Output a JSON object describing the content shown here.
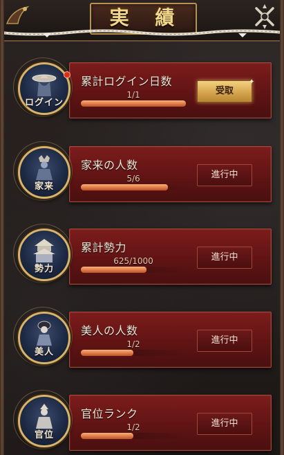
{
  "header": {
    "title": "実 績"
  },
  "achievements": [
    {
      "name": "累計ログイン日数",
      "progress_text": "1/1",
      "progress_ratio": 1.0,
      "badge_label": "ログイン",
      "button_label": "受取",
      "button_state": "claimable",
      "has_notification": true
    },
    {
      "name": "家来の人数",
      "progress_text": "5/6",
      "progress_ratio": 0.83,
      "badge_label": "家来",
      "button_label": "進行中",
      "button_state": "in-progress",
      "has_notification": false
    },
    {
      "name": "累計勢力",
      "progress_text": "625/1000",
      "progress_ratio": 0.625,
      "badge_label": "勢力",
      "button_label": "進行中",
      "button_state": "in-progress",
      "has_notification": false
    },
    {
      "name": "美人の人数",
      "progress_text": "1/2",
      "progress_ratio": 0.5,
      "badge_label": "美人",
      "button_label": "進行中",
      "button_state": "in-progress",
      "has_notification": false
    },
    {
      "name": "官位ランク",
      "progress_text": "1/2",
      "progress_ratio": 0.5,
      "badge_label": "官位",
      "button_label": "進行中",
      "button_state": "in-progress",
      "has_notification": false
    }
  ],
  "icons": {
    "badge_1": "samurai-hat-icon",
    "badge_2": "armored-samurai-icon",
    "badge_3": "castle-icon",
    "badge_4": "lady-icon",
    "badge_5": "official-icon"
  },
  "colors": {
    "card_red": "#6e1818",
    "gold": "#d8b36a",
    "progress_orange": "#e07a45",
    "claim_gold": "#d6a54e"
  }
}
